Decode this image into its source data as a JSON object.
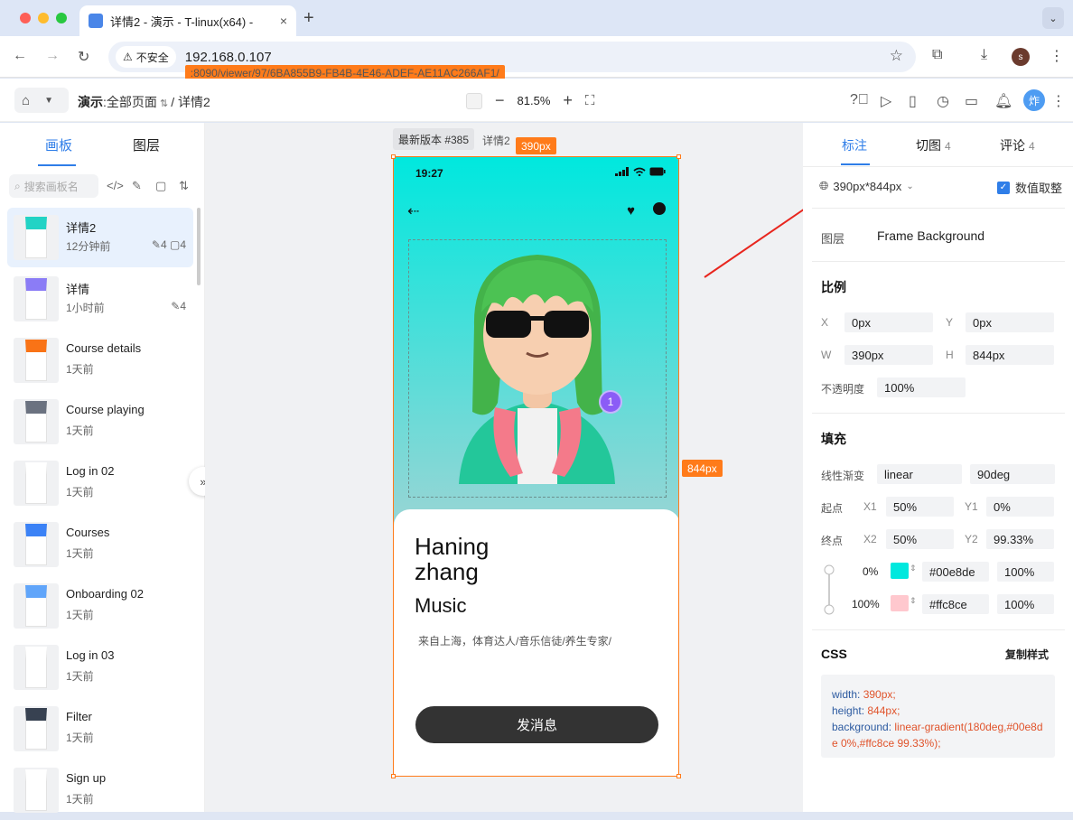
{
  "browser": {
    "tab_title": "详情2 - 演示 - T-linux(x64) - ",
    "tab_close": "×",
    "new_tab": "+",
    "security_label": "不安全",
    "url_host": "192.168.0.107",
    "url_rest": ":8090/viewer/97/6BA855B9-FB4B-4E46-ADEF-AE11AC266AF1/",
    "profile_initial": "s"
  },
  "toolbar": {
    "breadcrumb_project": "演示",
    "breadcrumb_sep1": ":",
    "breadcrumb_page": "全部页面",
    "breadcrumb_sep2": "/",
    "breadcrumb_board": "详情2",
    "zoom": "81.5%",
    "avatar_text": "炸"
  },
  "left_panel": {
    "tabs": [
      "画板",
      "图层"
    ],
    "search_placeholder": "搜索画板名",
    "boards": [
      {
        "name": "详情2",
        "time": "12分钟前",
        "stats": "✎4 ▢4",
        "selected": true
      },
      {
        "name": "详情",
        "time": "1小时前",
        "stats": "✎4"
      },
      {
        "name": "Course details",
        "time": "1天前"
      },
      {
        "name": "Course playing",
        "time": "1天前"
      },
      {
        "name": "Log in 02",
        "time": "1天前"
      },
      {
        "name": "Courses",
        "time": "1天前"
      },
      {
        "name": "Onboarding 02",
        "time": "1天前"
      },
      {
        "name": "Log in 03",
        "time": "1天前"
      },
      {
        "name": "Filter",
        "time": "1天前"
      },
      {
        "name": "Sign up",
        "time": "1天前"
      }
    ]
  },
  "canvas": {
    "version_label": "最新版本 #385",
    "page_label": "详情2",
    "width_label": "390px",
    "height_label": "844px",
    "phone": {
      "time": "19:27",
      "badge": "1",
      "name": "Haning\nzhang",
      "role": "Music",
      "description": "来自上海，体育达人/音乐信徒/养生专家/",
      "button": "发消息"
    }
  },
  "right_panel": {
    "tabs": [
      {
        "label": "标注",
        "count": ""
      },
      {
        "label": "切图",
        "count": "4"
      },
      {
        "label": "评论",
        "count": "4"
      }
    ],
    "size": "390px*844px",
    "integer_label": "数值取整",
    "layer_label": "图层",
    "layer_value": "Frame Background",
    "scale_title": "比例",
    "x_label": "X",
    "x_value": "0px",
    "y_label": "Y",
    "y_value": "0px",
    "w_label": "W",
    "w_value": "390px",
    "h_label": "H",
    "h_value": "844px",
    "opacity_label": "不透明度",
    "opacity_value": "100%",
    "fill_title": "填充",
    "gradient_label": "线性渐变",
    "gradient_type": "linear",
    "gradient_angle": "90deg",
    "start_label": "起点",
    "x1_label": "X1",
    "x1_value": "50%",
    "y1_label": "Y1",
    "y1_value": "0%",
    "end_label": "终点",
    "x2_label": "X2",
    "x2_value": "50%",
    "y2_label": "Y2",
    "y2_value": "99.33%",
    "stop1_pos": "0%",
    "stop1_color": "#00e8de",
    "stop1_alpha": "100%",
    "stop2_pos": "100%",
    "stop2_color": "#ffc8ce",
    "stop2_alpha": "100%",
    "css_title": "CSS",
    "copy_label": "复制样式",
    "css_width_key": "width:",
    "css_width_val": "390px;",
    "css_height_key": "height:",
    "css_height_val": "844px;",
    "css_bg_key": "background:",
    "css_bg_val": "linear-gradient(180deg,#00e8de 0%,#ffc8ce 99.33%);"
  },
  "colors": {
    "accent": "#2f7ee8",
    "dimension": "#ff7b1a",
    "gradient_start": "#00e8de",
    "gradient_end": "#ffc8ce"
  }
}
